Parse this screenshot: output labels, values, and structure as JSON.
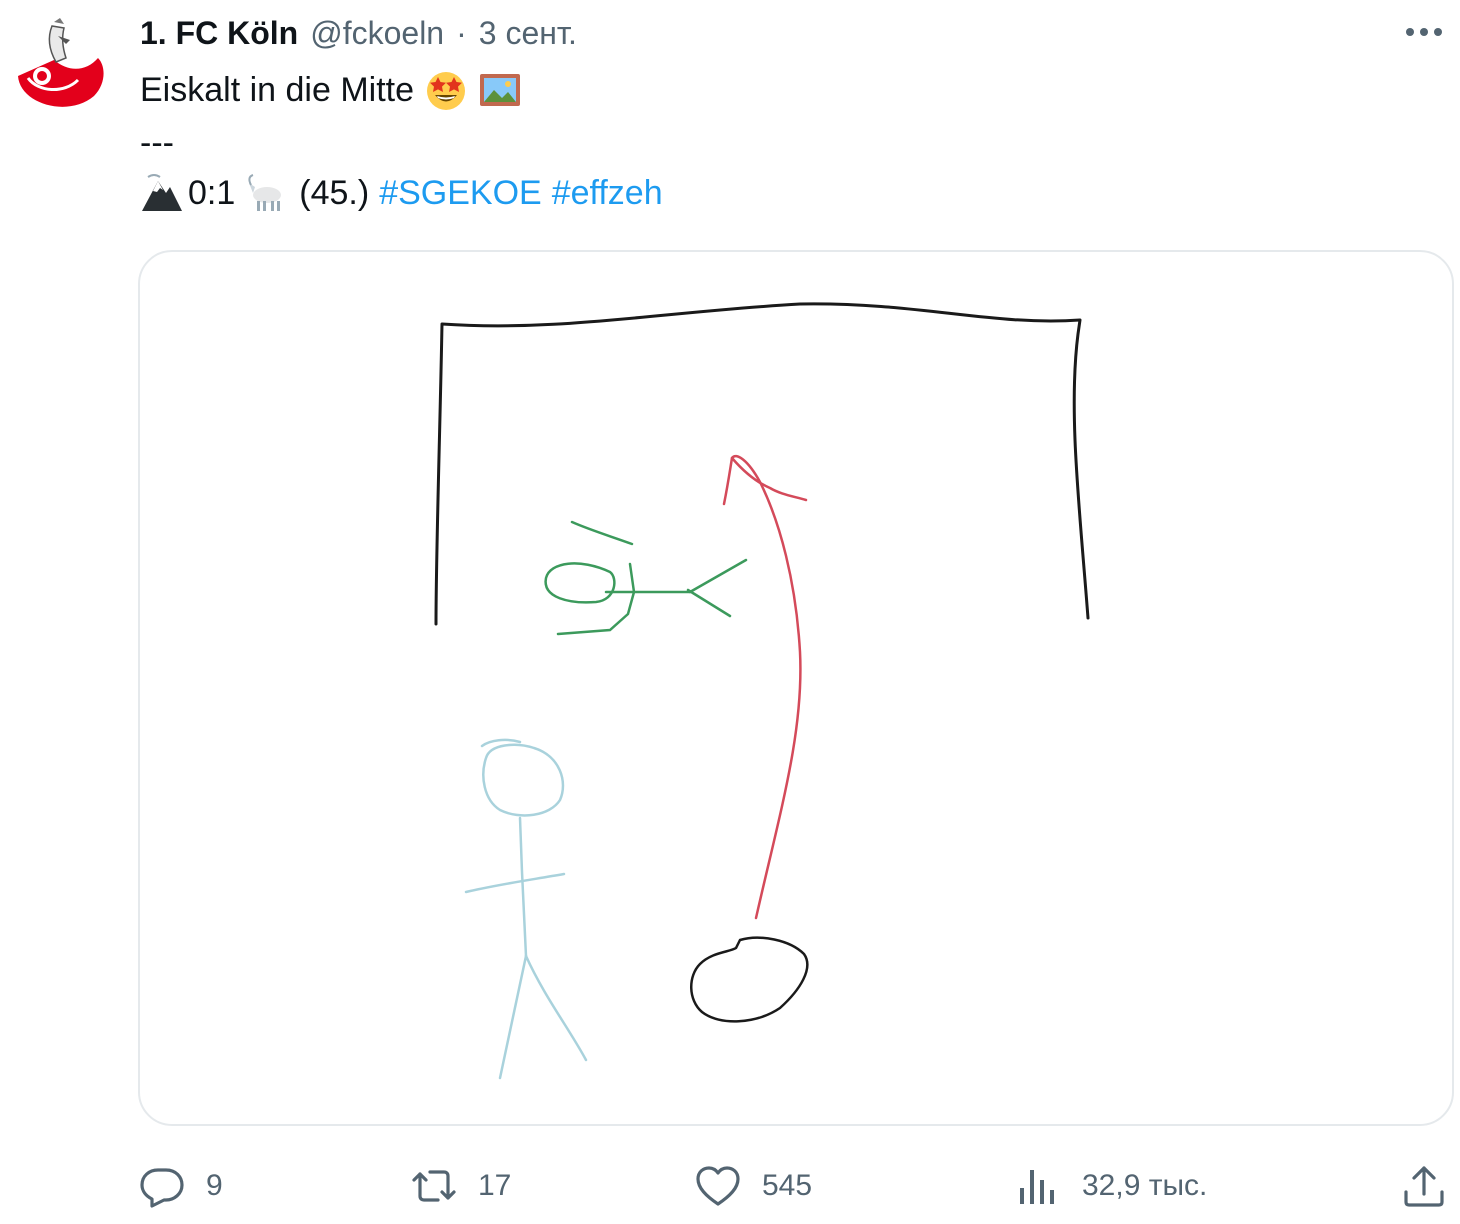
{
  "tweet": {
    "author_name": "1. FC Köln",
    "handle": "@fckoeln",
    "separator": "·",
    "date": "3 сент.",
    "text_line1": "Eiskalt in die Mitte",
    "text_line2": "---",
    "score_text": "0:1",
    "minute_text": "(45.)",
    "hashtags": [
      "#SGEKOE",
      "#effzeh"
    ],
    "emojis": [
      "star-struck-emoji",
      "framed-picture-emoji",
      "mountain-emoji",
      "goat-emoji"
    ]
  },
  "avatar": {
    "icon": "fc-koeln-crest-icon",
    "accent": "#e3001b"
  },
  "media": {
    "alt": "drawing",
    "colors": {
      "goal": "#1a1a1a",
      "keeper": "#3c9a5c",
      "shooter": "#a9d2dc",
      "arrow": "#d44a5a",
      "ball": "#1a1a1a"
    }
  },
  "actions": {
    "reply_count": "9",
    "retweet_count": "17",
    "like_count": "545",
    "views_count": "32,9 тыс."
  },
  "colors": {
    "hashtag": "#1d9bf0",
    "secondary_text": "#536471",
    "border": "#e5e9ec"
  }
}
